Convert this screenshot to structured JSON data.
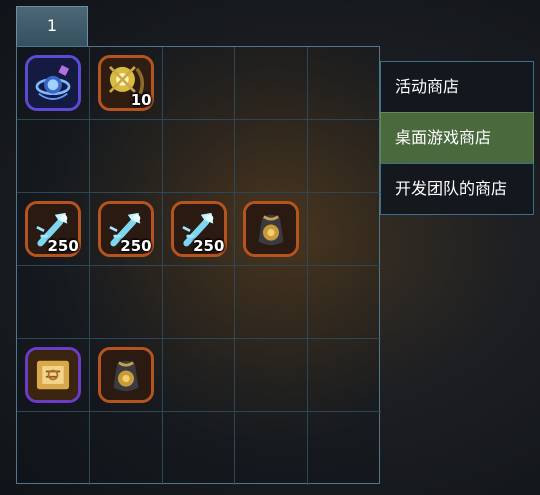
{
  "tabs": [
    {
      "label": "1"
    }
  ],
  "inventory": {
    "slots": [
      {
        "icon": "sapphire-artifact-icon",
        "qty": ""
      },
      {
        "icon": "golden-star-emblem-icon",
        "qty": "10"
      },
      {
        "icon": "blue-crystal-key-icon",
        "qty": "250"
      },
      {
        "icon": "blue-crystal-key-icon",
        "qty": "250"
      },
      {
        "icon": "blue-crystal-key-icon",
        "qty": "250"
      },
      {
        "icon": "treasure-pouch-icon",
        "qty": ""
      },
      {
        "icon": "scroll-map-icon",
        "qty": ""
      },
      {
        "icon": "treasure-pouch-icon",
        "qty": ""
      }
    ]
  },
  "shops": {
    "items": [
      {
        "label": "活动商店"
      },
      {
        "label": "桌面游戏商店"
      },
      {
        "label": "开发团队的商店"
      }
    ],
    "selected_index": 1
  },
  "colors": {
    "accent_green": "#4a6a3e",
    "frame_orange": "#b5541f",
    "frame_purple": "#6a3cc8"
  }
}
